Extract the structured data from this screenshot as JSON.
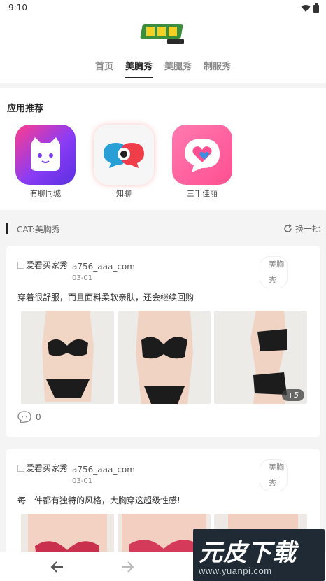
{
  "status": {
    "time": "9:10"
  },
  "tabs": [
    "首页",
    "美胸秀",
    "美腿秀",
    "制服秀"
  ],
  "apps_section": {
    "title": "应用推荐",
    "apps": [
      {
        "name": "有聊同城",
        "icon": "cat-chat-icon"
      },
      {
        "name": "知聊",
        "icon": "speech-bubbles-icon"
      },
      {
        "name": "三千佳丽",
        "icon": "heart-bubble-icon"
      }
    ]
  },
  "category": {
    "label": "CAT:美胸秀",
    "refresh": "换一批"
  },
  "posts": [
    {
      "avatar_alt": "爱看买家秀",
      "username": "a756_aaa_com",
      "date": "03-01",
      "tag": "美胸秀",
      "caption": "穿着很舒服，而且面料柔软亲肤，还会继续回购",
      "more": "+5",
      "comments": "0"
    },
    {
      "avatar_alt": "爱看买家秀",
      "username": "a756_aaa_com",
      "date": "03-01",
      "tag": "美胸秀",
      "caption": "每一件都有独特的风格，大胸穿这超级性感!"
    }
  ],
  "watermark": {
    "title": "元皮下载",
    "url": "www.yuanpi.com"
  },
  "colors": {
    "accent": "#222222",
    "watermark_bg": "#1f2a34"
  }
}
